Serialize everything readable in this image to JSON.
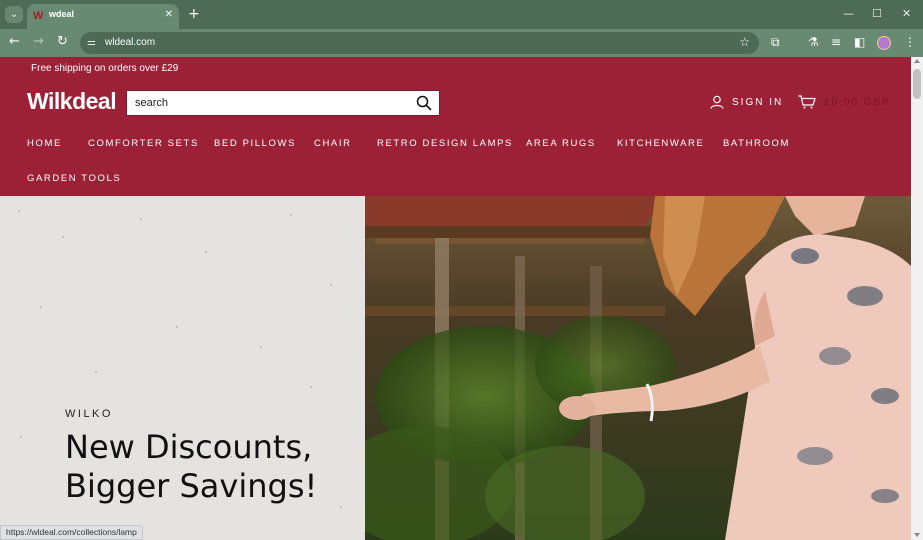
{
  "browser": {
    "tab_title": "wdeal",
    "tab_favicon": "W",
    "url": "wldeal.com",
    "status_url": "https://wldeal.com/collections/lamp"
  },
  "page": {
    "announcement": "Free shipping on orders over £29",
    "logo": "Wilkdeal",
    "search_placeholder": "search",
    "sign_in": "SIGN IN",
    "cart_total": "£0.00 GBP",
    "nav": [
      "HOME",
      "COMFORTER SETS",
      "BED PILLOWS",
      "CHAIR",
      "RETRO DESIGN LAMPS",
      "AREA RUGS",
      "KITCHENWARE",
      "BATHROOM",
      "GARDEN TOOLS"
    ],
    "hero": {
      "eyebrow": "WILKO",
      "title": "New Discounts, Bigger Savings!"
    }
  },
  "colors": {
    "brand": "#9c2137",
    "chrome": "#698a72",
    "chrome_dark": "#4d6b57"
  }
}
